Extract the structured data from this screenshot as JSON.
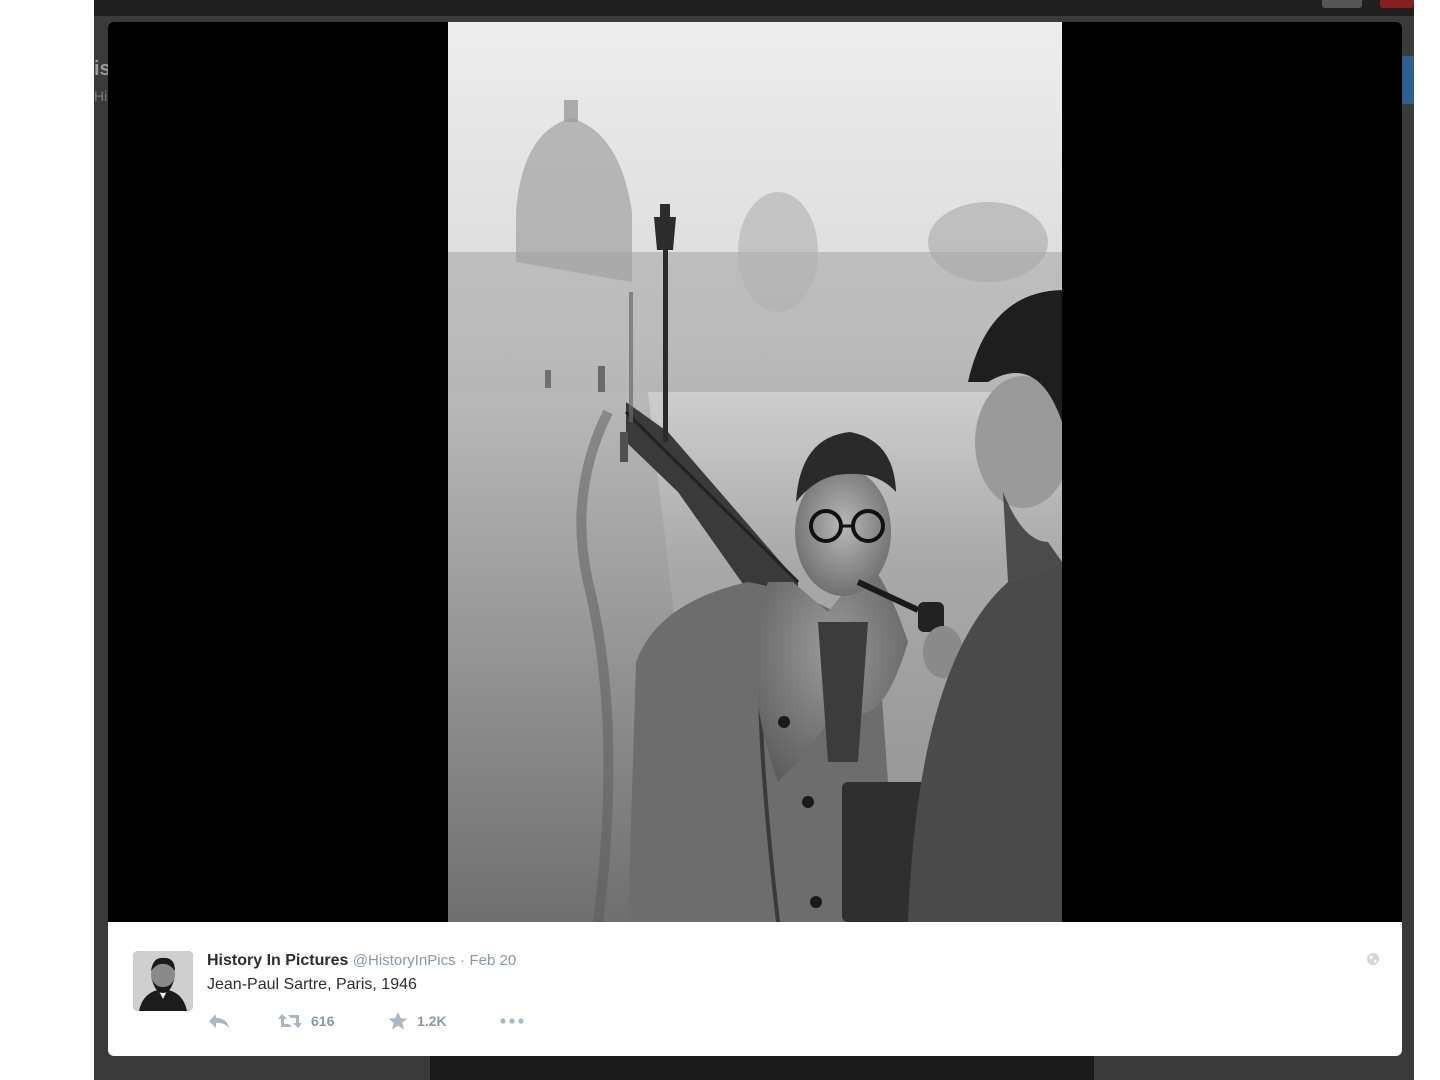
{
  "tweet": {
    "fullname": "History In Pictures",
    "handle": "@HistoryInPics",
    "separator": "·",
    "timestamp": "Feb 20",
    "text": "Jean-Paul Sartre, Paris, 1946",
    "retweet_count": "616",
    "favorite_count": "1.2K"
  },
  "background_page": {
    "header_fragment": "is",
    "subheader_fragment": "Hi"
  },
  "icons": {
    "reply": "reply-icon",
    "retweet": "retweet-icon",
    "favorite": "star-icon",
    "more": "more-icon",
    "globe": "globe-icon"
  },
  "colors": {
    "text_primary": "#292f33",
    "text_secondary": "#8899a6",
    "lightbox_bg": "#000000"
  }
}
